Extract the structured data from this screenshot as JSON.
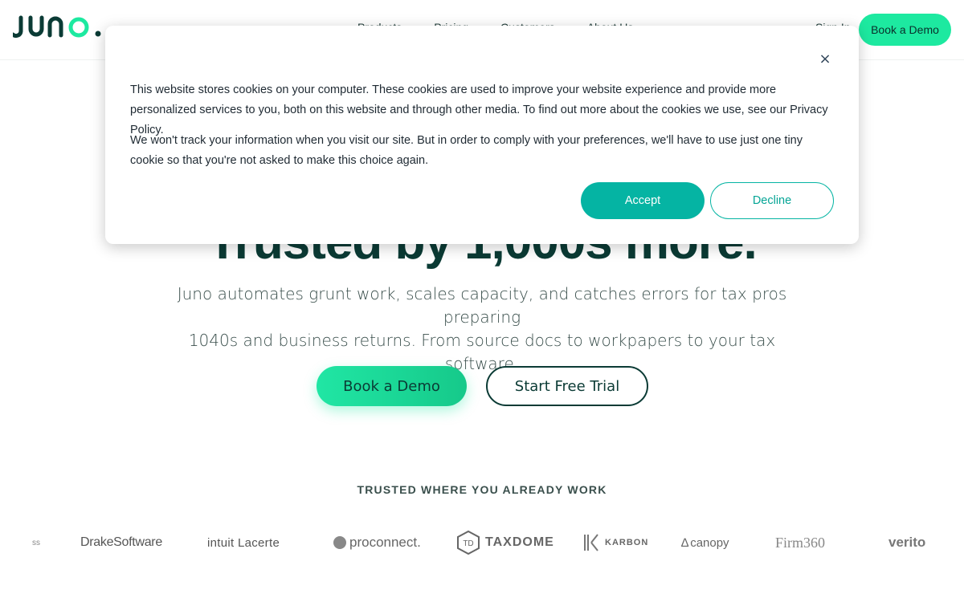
{
  "brand": {
    "name": "juno.",
    "accent": "#1de9a0",
    "dark": "#0b3b35",
    "teal": "#05b4a3"
  },
  "header": {
    "nav": [
      "Products",
      "Pricing",
      "Customers",
      "About Us"
    ],
    "signin": "Sign In",
    "cta": "Book a Demo"
  },
  "hero": {
    "title": "Trusted by 1,000s more.",
    "subtitle_line1": "Juno automates grunt work, scales capacity, and catches errors for tax pros preparing",
    "subtitle_line2": "1040s and business returns. From source docs to workpapers to your tax software.",
    "primary_cta": "Book a Demo",
    "secondary_cta": "Start Free Trial"
  },
  "trusted": {
    "heading": "TRUSTED WHERE YOU ALREADY WORK",
    "partners": {
      "edge": "ss",
      "drake": "DrakeSoftware",
      "lacerte": "intuit Lacerte",
      "proconnect": "proconnect.",
      "taxdome": "TAXDOME",
      "karbon": "KARBON",
      "canopy": "canopy",
      "firm360": "Firm360",
      "verito": "verito"
    }
  },
  "cookie": {
    "close": "×",
    "p1": "This website stores cookies on your computer. These cookies are used to improve your website experience and provide more personalized services to you, both on this website and through other media. To find out more about the cookies we use, see our Privacy Policy.",
    "p2": "We won't track your information when you visit our site. But in order to comply with your preferences, we'll have to use just one tiny cookie so that you're not asked to make this choice again.",
    "accept": "Accept",
    "decline": "Decline"
  }
}
